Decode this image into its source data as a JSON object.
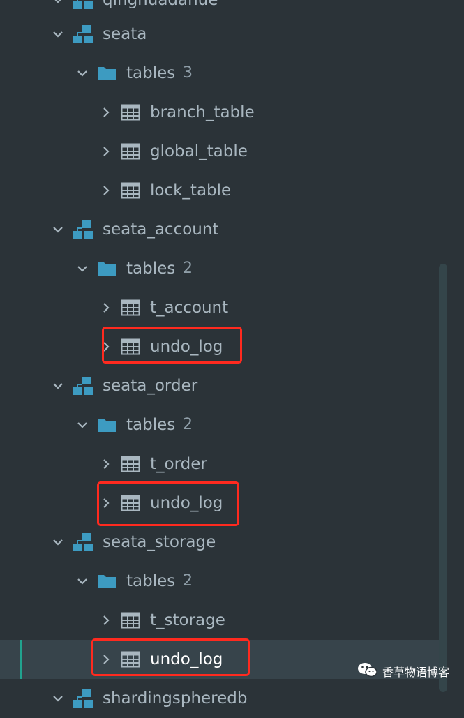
{
  "tree": {
    "top_partial": {
      "label": "qingnuadanue"
    },
    "schemas": [
      {
        "name": "seata",
        "folder": {
          "label": "tables",
          "count": "3"
        },
        "tables": [
          "branch_table",
          "global_table",
          "lock_table"
        ]
      },
      {
        "name": "seata_account",
        "folder": {
          "label": "tables",
          "count": "2"
        },
        "tables": [
          "t_account",
          "undo_log"
        ]
      },
      {
        "name": "seata_order",
        "folder": {
          "label": "tables",
          "count": "2"
        },
        "tables": [
          "t_order",
          "undo_log"
        ]
      },
      {
        "name": "seata_storage",
        "folder": {
          "label": "tables",
          "count": "2"
        },
        "tables": [
          "t_storage",
          "undo_log"
        ]
      }
    ],
    "bottom_partial": {
      "label": "shardingspheredb"
    }
  },
  "watermark": {
    "text": "香草物语博客",
    "icon": "wechat-icon"
  },
  "colors": {
    "background": "#2b3338",
    "schema_icon": "#3d9bc1",
    "folder_icon": "#3d9bc1",
    "highlight_box": "#ff2a1f",
    "selection_bar": "#21a38f"
  }
}
